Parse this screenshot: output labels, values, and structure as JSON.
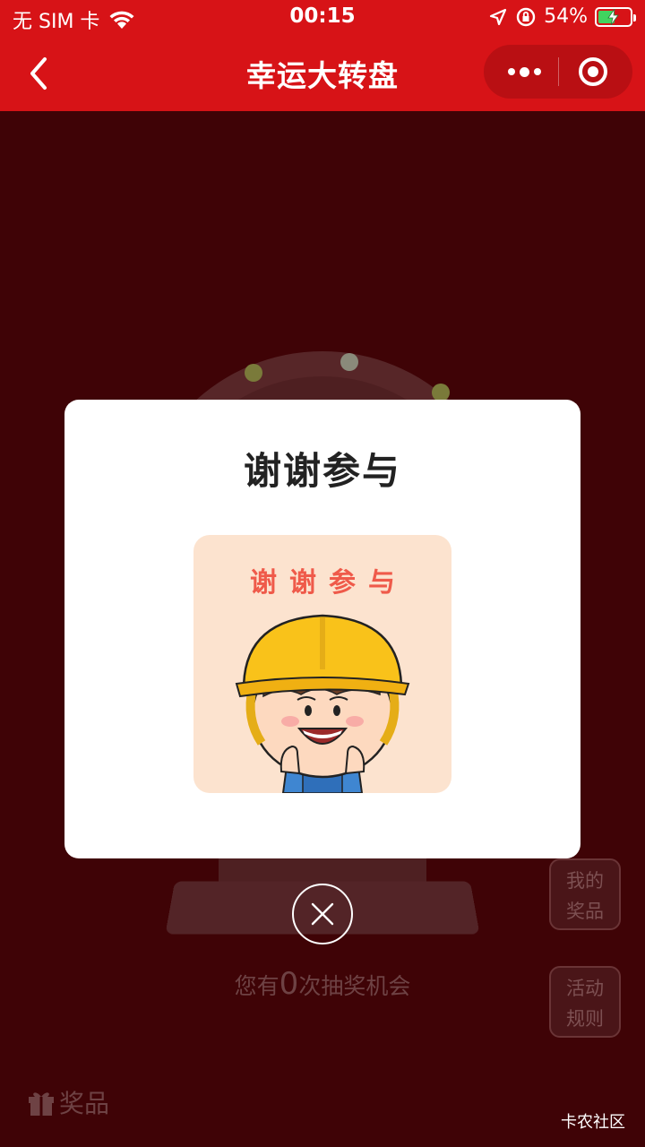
{
  "status_bar": {
    "carrier": "无 SIM 卡",
    "time": "00:15",
    "battery": "54%",
    "battery_level": 0.54
  },
  "nav": {
    "title": "幸运大转盘"
  },
  "side_buttons": {
    "my_prizes": "我的奖品",
    "rules": "活动规则"
  },
  "chances": {
    "prefix": "您有",
    "count": "0",
    "suffix": "次抽奖机会"
  },
  "bottom": {
    "prize_tab": "奖品",
    "watermark": "卡农社区"
  },
  "modal": {
    "title": "谢谢参与",
    "card_text": "谢谢参与"
  },
  "colors": {
    "brand_red": "#d71317",
    "overlay_bg": "#3f0306",
    "card_bg": "#fce3cf",
    "card_text": "#ef5a4a",
    "helmet": "#f9c21a"
  }
}
